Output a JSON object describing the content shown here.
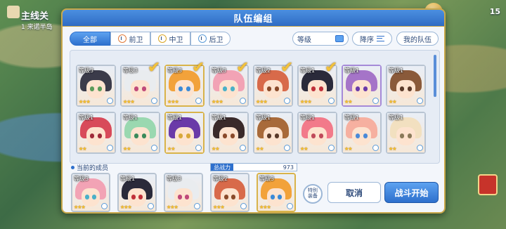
{
  "background": {
    "left_title": "主线关",
    "left_sub": "1 来诺半岛",
    "right_num": "15"
  },
  "dialog": {
    "title": "队伍编组"
  },
  "filters": {
    "all": "全部",
    "front": "前卫",
    "mid": "中卫",
    "back": "后卫"
  },
  "sort": {
    "level": "等级",
    "order": "降序",
    "my_team": "我的队伍"
  },
  "roster": {
    "row1": [
      {
        "level": "等级3",
        "stars": "★★★",
        "hair": "#3b3b4a",
        "eye": "#5a9b5a",
        "border": "silver",
        "checked": false
      },
      {
        "level": "等级3",
        "stars": "★★★",
        "hair": "#e9ecef",
        "eye": "#c04a7a",
        "border": "silver",
        "checked": true
      },
      {
        "level": "等级3",
        "stars": "★★★",
        "hair": "#f2a23a",
        "eye": "#3a8ad8",
        "border": "gold",
        "checked": true
      },
      {
        "level": "等级3",
        "stars": "★★★",
        "hair": "#f2a3b5",
        "eye": "#4ab0c8",
        "border": "silver",
        "checked": true
      },
      {
        "level": "等级2",
        "stars": "★★★",
        "hair": "#d86a4a",
        "eye": "#8a4a2a",
        "border": "silver",
        "checked": true
      },
      {
        "level": "等级1",
        "stars": "★★★",
        "hair": "#2a2a3a",
        "eye": "#c0303a",
        "border": "silver",
        "checked": true
      },
      {
        "level": "等级1",
        "stars": "★★",
        "hair": "#a574c8",
        "eye": "#6a3aa8",
        "border": "purple",
        "checked": false
      },
      {
        "level": "等级1",
        "stars": "★★",
        "hair": "#8a5a3a",
        "eye": "#5a3a2a",
        "border": "silver",
        "checked": false
      }
    ],
    "row2": [
      {
        "level": "等级1",
        "stars": "★★",
        "hair": "#d84a5a",
        "eye": "#a02a3a",
        "border": "silver",
        "checked": false
      },
      {
        "level": "等级1",
        "stars": "★★",
        "hair": "#9ad8b0",
        "eye": "#3a8a5a",
        "border": "silver",
        "checked": false
      },
      {
        "level": "等级1",
        "stars": "★★",
        "hair": "#6a3aa8",
        "eye": "#d8a83a",
        "border": "gold",
        "checked": false
      },
      {
        "level": "等级1",
        "stars": "★★",
        "hair": "#3a2a2a",
        "eye": "#8a4a2a",
        "border": "silver",
        "checked": false
      },
      {
        "level": "等级1",
        "stars": "★★",
        "hair": "#a86a3a",
        "eye": "#5a3a2a",
        "border": "silver",
        "checked": false
      },
      {
        "level": "等级1",
        "stars": "★★",
        "hair": "#f27a8a",
        "eye": "#c04a5a",
        "border": "silver",
        "checked": false
      },
      {
        "level": "等级1",
        "stars": "★★",
        "hair": "#f6b0a0",
        "eye": "#4a8ad8",
        "border": "silver",
        "checked": false
      },
      {
        "level": "等级1",
        "stars": "★★",
        "hair": "#f2e0c0",
        "eye": "#8a7a5a",
        "border": "silver",
        "checked": false
      }
    ]
  },
  "team": {
    "label": "当前的成员",
    "power_label": "总战力",
    "power_value": "973",
    "members": [
      {
        "level": "等级3",
        "stars": "★★★",
        "hair": "#f2a3b5",
        "eye": "#4ab0c8",
        "border": "silver"
      },
      {
        "level": "等级1",
        "stars": "★★★",
        "hair": "#2a2a3a",
        "eye": "#c0303a",
        "border": "silver"
      },
      {
        "level": "等级3",
        "stars": "★★★",
        "hair": "#e9ecef",
        "eye": "#c04a7a",
        "border": "silver"
      },
      {
        "level": "等级2",
        "stars": "★★★",
        "hair": "#d86a4a",
        "eye": "#8a4a2a",
        "border": "silver"
      },
      {
        "level": "等级3",
        "stars": "★★★",
        "hair": "#f2a23a",
        "eye": "#3a8ad8",
        "border": "gold"
      }
    ]
  },
  "buttons": {
    "equip": "特别\n装备",
    "cancel": "取消",
    "start": "战斗开始"
  },
  "colors": {
    "header": "#2f6cc4",
    "accent": "#2e70cd",
    "frame_gold": "#c9a84a",
    "check": "#f2c23a"
  }
}
